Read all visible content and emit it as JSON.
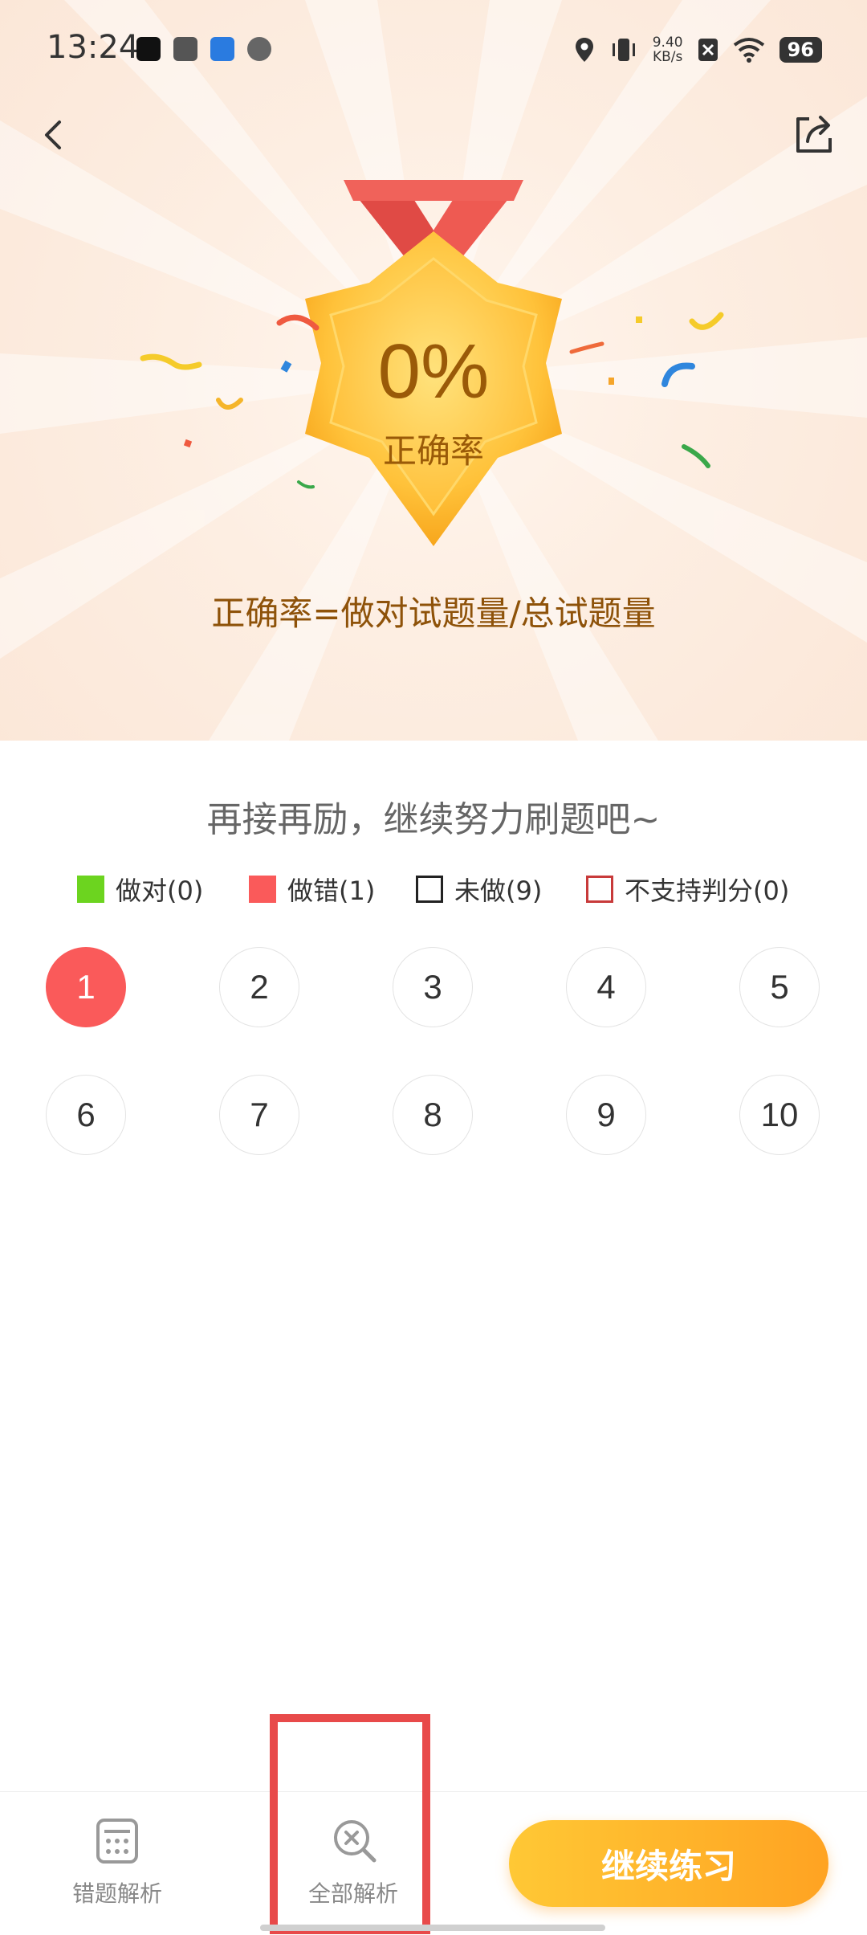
{
  "status_bar": {
    "time": "13:24",
    "net_speed_value": "9.40",
    "net_speed_unit": "KB/s",
    "battery": "96"
  },
  "result": {
    "accuracy": "0%",
    "accuracy_label": "正确率",
    "formula": "正确率=做对试题量/总试题量",
    "encourage": "再接再励，继续努力刷题吧~"
  },
  "legend": [
    {
      "label": "做对(0)",
      "color": "#6cd41f"
    },
    {
      "label": "做错(1)",
      "color": "#fa5a5a"
    },
    {
      "label": "未做(9)",
      "color": "#222222"
    },
    {
      "label": "不支持判分(0)",
      "color": "#c83a3a"
    }
  ],
  "questions": [
    {
      "num": "1",
      "status": "wrong"
    },
    {
      "num": "2",
      "status": "undone"
    },
    {
      "num": "3",
      "status": "undone"
    },
    {
      "num": "4",
      "status": "undone"
    },
    {
      "num": "5",
      "status": "undone"
    },
    {
      "num": "6",
      "status": "undone"
    },
    {
      "num": "7",
      "status": "undone"
    },
    {
      "num": "8",
      "status": "undone"
    },
    {
      "num": "9",
      "status": "undone"
    },
    {
      "num": "10",
      "status": "undone"
    }
  ],
  "bottom_bar": {
    "wrong_analysis": "错题解析",
    "all_analysis": "全部解析",
    "continue": "继续练习"
  },
  "colors": {
    "accent": "#ffb22c",
    "wrong": "#fa5a5a",
    "correct": "#6cd41f",
    "highlight_box": "#e84a4a"
  }
}
